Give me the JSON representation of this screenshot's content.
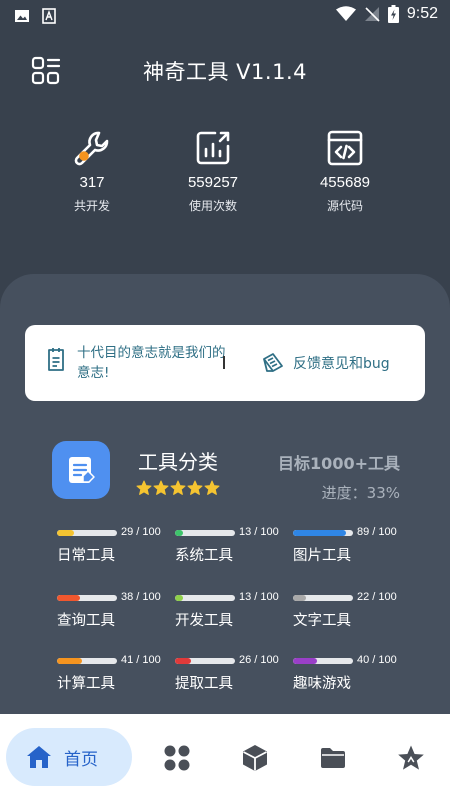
{
  "status_bar": {
    "time": "9:52"
  },
  "header": {
    "title": "神奇工具 V1.1.4"
  },
  "stats": [
    {
      "icon": "wrench-icon",
      "value": "317",
      "label": "共开发"
    },
    {
      "icon": "chart-icon",
      "value": "559257",
      "label": "使用次数"
    },
    {
      "icon": "code-icon",
      "value": "455689",
      "label": "源代码"
    }
  ],
  "banner": {
    "motto": "十代目的意志就是我们的意志!",
    "feedback": "反馈意见和bug"
  },
  "category": {
    "title": "工具分类",
    "rating": 5,
    "goal": "目标1000+工具",
    "progress": "进度：33%",
    "tools": [
      {
        "name": "日常工具",
        "count": "29 / 100",
        "value": 0.29,
        "color": "#f5c431"
      },
      {
        "name": "系统工具",
        "count": "13 / 100",
        "value": 0.13,
        "color": "#3ec46b"
      },
      {
        "name": "图片工具",
        "count": "89 / 100",
        "value": 0.89,
        "color": "#2f86e6"
      },
      {
        "name": "查询工具",
        "count": "38 / 100",
        "value": 0.38,
        "color": "#f0572e"
      },
      {
        "name": "开发工具",
        "count": "13 / 100",
        "value": 0.13,
        "color": "#8fd04a"
      },
      {
        "name": "文字工具",
        "count": "22 / 100",
        "value": 0.22,
        "color": "#a9a9a9"
      },
      {
        "name": "计算工具",
        "count": "41 / 100",
        "value": 0.41,
        "color": "#f5941f"
      },
      {
        "name": "提取工具",
        "count": "26 / 100",
        "value": 0.26,
        "color": "#e03a3a"
      },
      {
        "name": "趣味游戏",
        "count": "40 / 100",
        "value": 0.4,
        "color": "#9a3fc8"
      }
    ]
  },
  "bottom_nav": {
    "home_label": "首页",
    "active_color": "#2663c9",
    "items": [
      "home-icon",
      "apps-icon",
      "cube-icon",
      "folder-icon",
      "star-icon"
    ]
  }
}
